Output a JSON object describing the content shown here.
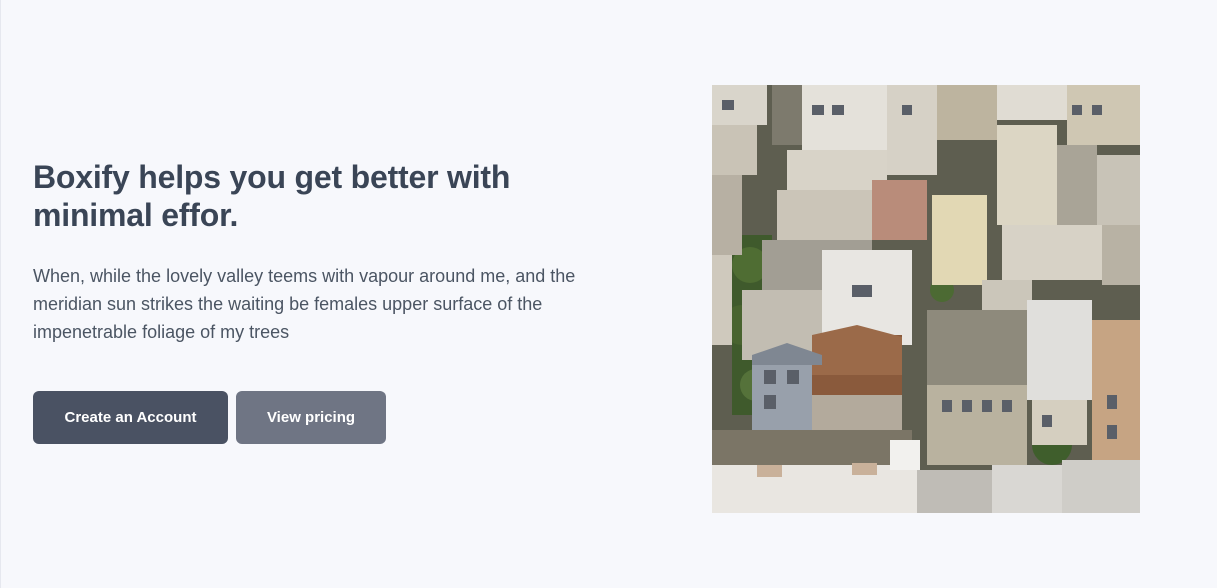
{
  "hero": {
    "headline": "Boxify helps you get better with minimal effor.",
    "description": "When, while the lovely valley teems with vapour around me, and the meridian sun strikes the waiting be females upper surface of the impenetrable foliage of my trees",
    "primary_button_label": "Create an Account",
    "secondary_button_label": "View pricing"
  },
  "colors": {
    "background": "#f7f8fc",
    "headline": "#3a4556",
    "body_text": "#4b5563",
    "primary_button": "#4a5263",
    "secondary_button": "#6f7584"
  },
  "image": {
    "subject": "aerial-city-rooftops"
  }
}
